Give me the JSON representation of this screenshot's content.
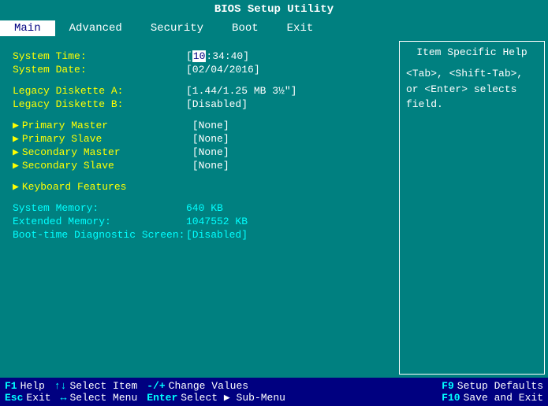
{
  "title": "BIOS Setup Utility",
  "menu": {
    "items": [
      {
        "label": "Main",
        "active": true
      },
      {
        "label": "Advanced",
        "active": false
      },
      {
        "label": "Security",
        "active": false
      },
      {
        "label": "Boot",
        "active": false
      },
      {
        "label": "Exit",
        "active": false
      }
    ]
  },
  "help": {
    "title": "Item Specific Help",
    "text": "<Tab>, <Shift-Tab>, or <Enter> selects field."
  },
  "fields": {
    "system_time_label": "System Time:",
    "system_time_value": "[10:34:40]",
    "system_time_highlight": "10",
    "system_date_label": "System Date:",
    "system_date_value": "[02/04/2016]",
    "legacy_a_label": "Legacy Diskette A:",
    "legacy_a_value": "[1.44/1.25 MB  3½\"]",
    "legacy_b_label": "Legacy Diskette B:",
    "legacy_b_value": "[Disabled]",
    "primary_master_label": "Primary Master",
    "primary_master_value": "[None]",
    "primary_slave_label": "Primary Slave",
    "primary_slave_value": "[None]",
    "secondary_master_label": "Secondary Master",
    "secondary_master_value": "[None]",
    "secondary_slave_label": "Secondary Slave",
    "secondary_slave_value": "[None]",
    "keyboard_features_label": "Keyboard Features",
    "system_memory_label": "System Memory:",
    "system_memory_value": "640 KB",
    "extended_memory_label": "Extended Memory:",
    "extended_memory_value": "1047552 KB",
    "boot_diag_label": "Boot-time Diagnostic Screen:",
    "boot_diag_value": "[Disabled]"
  },
  "statusbar": {
    "f1": "F1",
    "f1_desc": "Help",
    "updown": "↑↓",
    "updown_desc": "Select Item",
    "plusminus": "-/+",
    "plusminus_desc": "Change Values",
    "f9": "F9",
    "f9_desc": "Setup Defaults",
    "esc": "Esc",
    "esc_desc": "Exit",
    "leftright": "↔",
    "leftright_desc": "Select Menu",
    "enter": "Enter",
    "enter_desc": "Select ▶ Sub-Menu",
    "f10": "F10",
    "f10_desc": "Save and Exit"
  }
}
